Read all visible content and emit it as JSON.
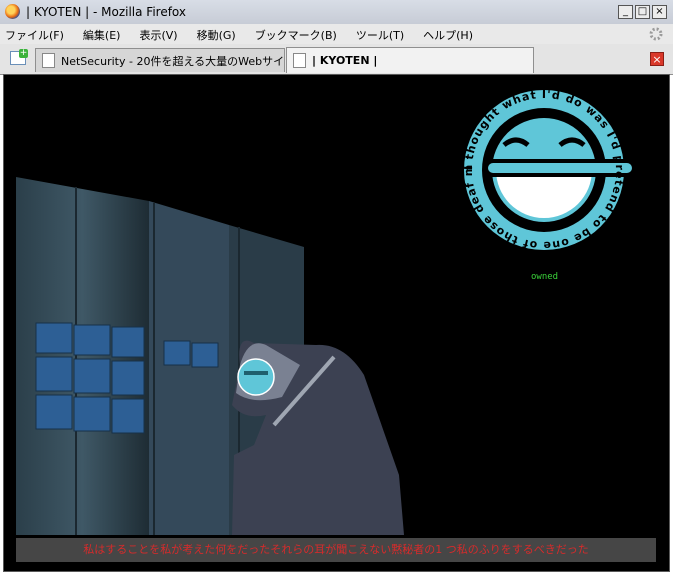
{
  "window": {
    "title": "| KYOTEN | - Mozilla Firefox",
    "minimize": "_",
    "maximize": "□",
    "close": "×"
  },
  "menu": {
    "items": [
      "ファイル(F)",
      "編集(E)",
      "表示(V)",
      "移動(G)",
      "ブックマーク(B)",
      "ツール(T)",
      "ヘルプ(H)"
    ]
  },
  "tabs": [
    {
      "label": "NetSecurity - 20件を超える大量のWebサイ..."
    },
    {
      "label": "| KYOTEN |"
    }
  ],
  "page": {
    "logo_ring_text": "I thought what I'd do was I'd pretend to be one of those deaf mutes",
    "logo_caption": "owned",
    "footer_text": "私はすることを私が考えた何をだったそれらの耳が聞こえない黙秘者の1 つ私のふりをするべきだった",
    "colors": {
      "background": "#000000",
      "logo": "#5fc6d8",
      "caption": "#3ad23a",
      "footer_text": "#d62b2b"
    }
  }
}
